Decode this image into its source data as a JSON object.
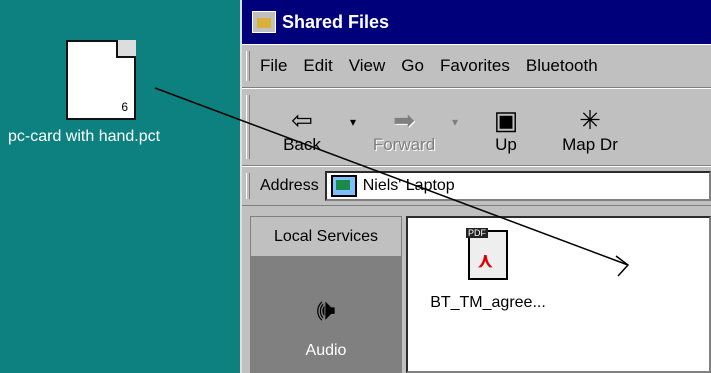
{
  "desktop": {
    "file": {
      "label": "pc-card with hand.pct",
      "badge": "6",
      "icon": "pict-file-icon"
    }
  },
  "window": {
    "title": "Shared Files",
    "menu": [
      "File",
      "Edit",
      "View",
      "Go",
      "Favorites",
      "Bluetooth"
    ],
    "toolbar": [
      {
        "label": "Back",
        "icon": "back-arrow-icon",
        "enabled": true
      },
      {
        "label": "Forward",
        "icon": "forward-arrow-icon",
        "enabled": false
      },
      {
        "label": "Up",
        "icon": "up-folder-icon",
        "enabled": true
      },
      {
        "label": "Map Dr",
        "icon": "map-drive-icon",
        "enabled": true
      }
    ],
    "address": {
      "label": "Address",
      "value": "Niels' Laptop"
    },
    "services": {
      "header": "Local Services",
      "item": "Audio"
    },
    "files": [
      {
        "name": "BT_TM_agree...",
        "icon": "pdf-file-icon",
        "tag": "PDF"
      }
    ]
  },
  "colors": {
    "desktop": "#0d8080",
    "titlebar": "#00007b",
    "chrome": "#c0c0c0"
  }
}
